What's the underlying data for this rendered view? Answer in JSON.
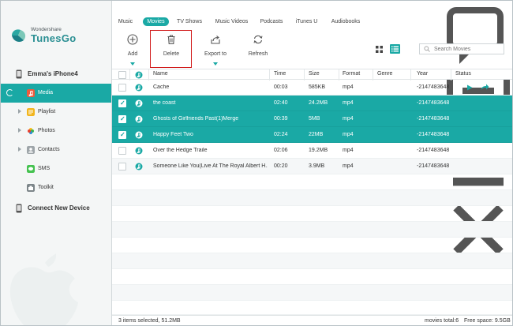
{
  "app": {
    "brand_small": "Wondershare",
    "brand_name": "TunesGo",
    "accent_color": "#1aa9a5"
  },
  "sidebar": {
    "device_name": "Emma's iPhone4",
    "items": [
      {
        "label": "Media",
        "active": true,
        "icon": "media-icon"
      },
      {
        "label": "Playlist",
        "icon": "playlist-icon"
      },
      {
        "label": "Photos",
        "icon": "photos-icon"
      },
      {
        "label": "Contacts",
        "icon": "contacts-icon"
      },
      {
        "label": "SMS",
        "icon": "sms-icon"
      },
      {
        "label": "Toolkit",
        "icon": "toolkit-icon"
      }
    ],
    "connect_label": "Connect New Device"
  },
  "tabs": [
    "Music",
    "Movies",
    "TV Shows",
    "Music Videos",
    "Podcasts",
    "iTunes U",
    "Audiobooks"
  ],
  "active_tab": "Movies",
  "toolbar": {
    "add": "Add",
    "delete": "Delete",
    "export": "Export to",
    "refresh": "Refresh",
    "search_placeholder": "Search Movies"
  },
  "table": {
    "headers": {
      "name": "Name",
      "time": "Time",
      "size": "Size",
      "format": "Format",
      "genre": "Genre",
      "year": "Year",
      "status": "Status"
    },
    "rows": [
      {
        "name": "Cache",
        "time": "00:03",
        "size": "585KB",
        "format": "mp4",
        "genre": "",
        "year": "-2147483648",
        "selected": false
      },
      {
        "name": "the coast",
        "time": "02:40",
        "size": "24.2MB",
        "format": "mp4",
        "genre": "",
        "year": "-2147483648",
        "selected": true
      },
      {
        "name": "Ghosts of Girlfriends Past(1)Merge",
        "time": "00:39",
        "size": "5MB",
        "format": "mp4",
        "genre": "",
        "year": "-2147483648",
        "selected": true
      },
      {
        "name": "Happy Feet Two",
        "time": "02:24",
        "size": "22MB",
        "format": "mp4",
        "genre": "",
        "year": "-2147483648",
        "selected": true
      },
      {
        "name": "Over the Hedge Traile",
        "time": "02:06",
        "size": "19.2MB",
        "format": "mp4",
        "genre": "",
        "year": "-2147483648",
        "selected": false
      },
      {
        "name": "Someone Like You(Live At The Royal Albert H...",
        "time": "00:20",
        "size": "3.9MB",
        "format": "mp4",
        "genre": "",
        "year": "-2147483648",
        "selected": false
      }
    ]
  },
  "status": {
    "selection": "3 items selected, 51.2MB",
    "total": "movies total:6",
    "free": "Free space: 9.5GB"
  }
}
